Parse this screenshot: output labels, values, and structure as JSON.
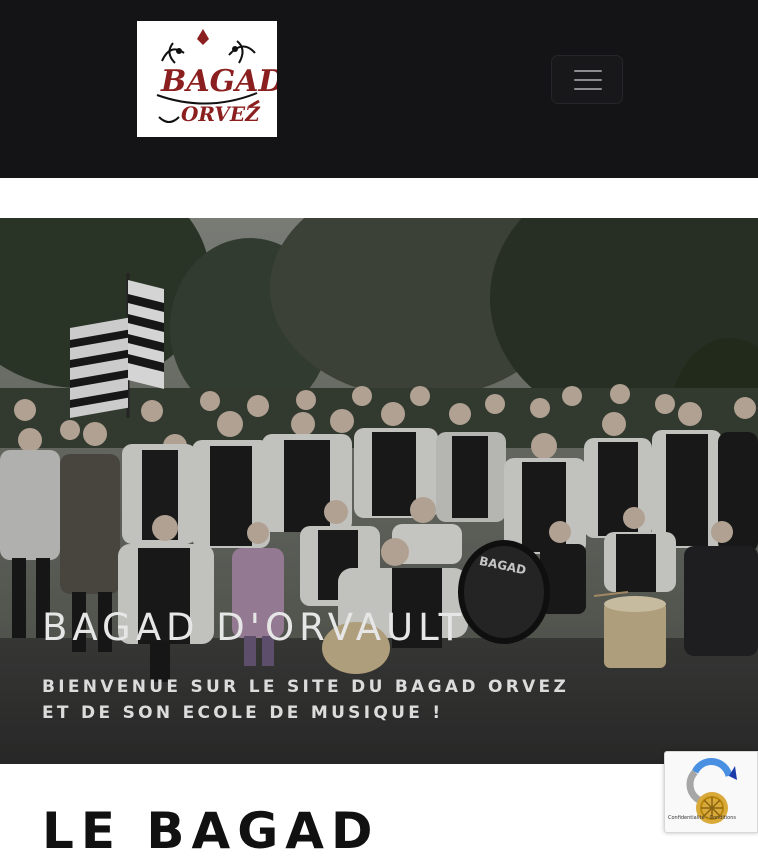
{
  "header": {
    "logo_alt": "BAGAD ORVEZ",
    "menu_button_label": "Menu"
  },
  "hero": {
    "title": "BAGAD D'ORVAULT",
    "subtitle": "BIENVENUE SUR LE SITE DU BAGAD ORVEZ ET DE SON ECOLE DE MUSIQUE !",
    "drum_text": "BAGAD"
  },
  "section": {
    "title": "LE BAGAD"
  },
  "recaptcha": {
    "links": "Confidentialité - Conditions"
  },
  "colors": {
    "header_bg": "#141416",
    "logo_red": "#8b1e1e"
  }
}
